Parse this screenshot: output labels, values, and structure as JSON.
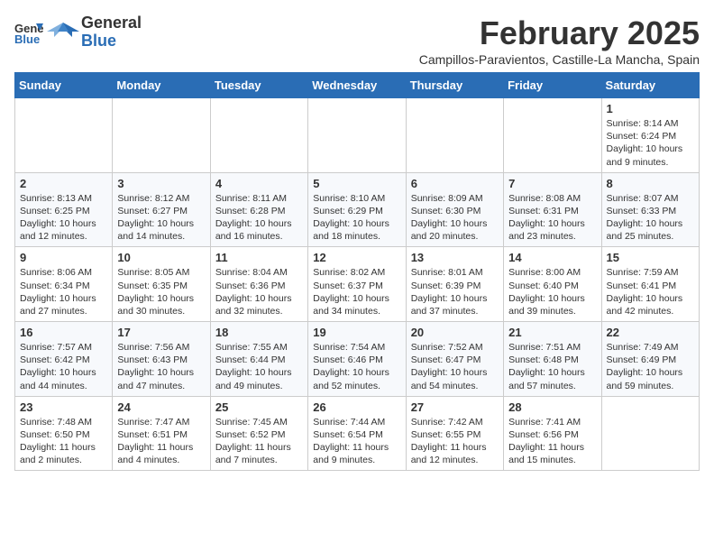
{
  "logo": {
    "general": "General",
    "blue": "Blue"
  },
  "header": {
    "month": "February 2025",
    "location": "Campillos-Paravientos, Castille-La Mancha, Spain"
  },
  "days_of_week": [
    "Sunday",
    "Monday",
    "Tuesday",
    "Wednesday",
    "Thursday",
    "Friday",
    "Saturday"
  ],
  "weeks": [
    [
      {
        "num": "",
        "info": ""
      },
      {
        "num": "",
        "info": ""
      },
      {
        "num": "",
        "info": ""
      },
      {
        "num": "",
        "info": ""
      },
      {
        "num": "",
        "info": ""
      },
      {
        "num": "",
        "info": ""
      },
      {
        "num": "1",
        "info": "Sunrise: 8:14 AM\nSunset: 6:24 PM\nDaylight: 10 hours\nand 9 minutes."
      }
    ],
    [
      {
        "num": "2",
        "info": "Sunrise: 8:13 AM\nSunset: 6:25 PM\nDaylight: 10 hours\nand 12 minutes."
      },
      {
        "num": "3",
        "info": "Sunrise: 8:12 AM\nSunset: 6:27 PM\nDaylight: 10 hours\nand 14 minutes."
      },
      {
        "num": "4",
        "info": "Sunrise: 8:11 AM\nSunset: 6:28 PM\nDaylight: 10 hours\nand 16 minutes."
      },
      {
        "num": "5",
        "info": "Sunrise: 8:10 AM\nSunset: 6:29 PM\nDaylight: 10 hours\nand 18 minutes."
      },
      {
        "num": "6",
        "info": "Sunrise: 8:09 AM\nSunset: 6:30 PM\nDaylight: 10 hours\nand 20 minutes."
      },
      {
        "num": "7",
        "info": "Sunrise: 8:08 AM\nSunset: 6:31 PM\nDaylight: 10 hours\nand 23 minutes."
      },
      {
        "num": "8",
        "info": "Sunrise: 8:07 AM\nSunset: 6:33 PM\nDaylight: 10 hours\nand 25 minutes."
      }
    ],
    [
      {
        "num": "9",
        "info": "Sunrise: 8:06 AM\nSunset: 6:34 PM\nDaylight: 10 hours\nand 27 minutes."
      },
      {
        "num": "10",
        "info": "Sunrise: 8:05 AM\nSunset: 6:35 PM\nDaylight: 10 hours\nand 30 minutes."
      },
      {
        "num": "11",
        "info": "Sunrise: 8:04 AM\nSunset: 6:36 PM\nDaylight: 10 hours\nand 32 minutes."
      },
      {
        "num": "12",
        "info": "Sunrise: 8:02 AM\nSunset: 6:37 PM\nDaylight: 10 hours\nand 34 minutes."
      },
      {
        "num": "13",
        "info": "Sunrise: 8:01 AM\nSunset: 6:39 PM\nDaylight: 10 hours\nand 37 minutes."
      },
      {
        "num": "14",
        "info": "Sunrise: 8:00 AM\nSunset: 6:40 PM\nDaylight: 10 hours\nand 39 minutes."
      },
      {
        "num": "15",
        "info": "Sunrise: 7:59 AM\nSunset: 6:41 PM\nDaylight: 10 hours\nand 42 minutes."
      }
    ],
    [
      {
        "num": "16",
        "info": "Sunrise: 7:57 AM\nSunset: 6:42 PM\nDaylight: 10 hours\nand 44 minutes."
      },
      {
        "num": "17",
        "info": "Sunrise: 7:56 AM\nSunset: 6:43 PM\nDaylight: 10 hours\nand 47 minutes."
      },
      {
        "num": "18",
        "info": "Sunrise: 7:55 AM\nSunset: 6:44 PM\nDaylight: 10 hours\nand 49 minutes."
      },
      {
        "num": "19",
        "info": "Sunrise: 7:54 AM\nSunset: 6:46 PM\nDaylight: 10 hours\nand 52 minutes."
      },
      {
        "num": "20",
        "info": "Sunrise: 7:52 AM\nSunset: 6:47 PM\nDaylight: 10 hours\nand 54 minutes."
      },
      {
        "num": "21",
        "info": "Sunrise: 7:51 AM\nSunset: 6:48 PM\nDaylight: 10 hours\nand 57 minutes."
      },
      {
        "num": "22",
        "info": "Sunrise: 7:49 AM\nSunset: 6:49 PM\nDaylight: 10 hours\nand 59 minutes."
      }
    ],
    [
      {
        "num": "23",
        "info": "Sunrise: 7:48 AM\nSunset: 6:50 PM\nDaylight: 11 hours\nand 2 minutes."
      },
      {
        "num": "24",
        "info": "Sunrise: 7:47 AM\nSunset: 6:51 PM\nDaylight: 11 hours\nand 4 minutes."
      },
      {
        "num": "25",
        "info": "Sunrise: 7:45 AM\nSunset: 6:52 PM\nDaylight: 11 hours\nand 7 minutes."
      },
      {
        "num": "26",
        "info": "Sunrise: 7:44 AM\nSunset: 6:54 PM\nDaylight: 11 hours\nand 9 minutes."
      },
      {
        "num": "27",
        "info": "Sunrise: 7:42 AM\nSunset: 6:55 PM\nDaylight: 11 hours\nand 12 minutes."
      },
      {
        "num": "28",
        "info": "Sunrise: 7:41 AM\nSunset: 6:56 PM\nDaylight: 11 hours\nand 15 minutes."
      },
      {
        "num": "",
        "info": ""
      }
    ]
  ]
}
